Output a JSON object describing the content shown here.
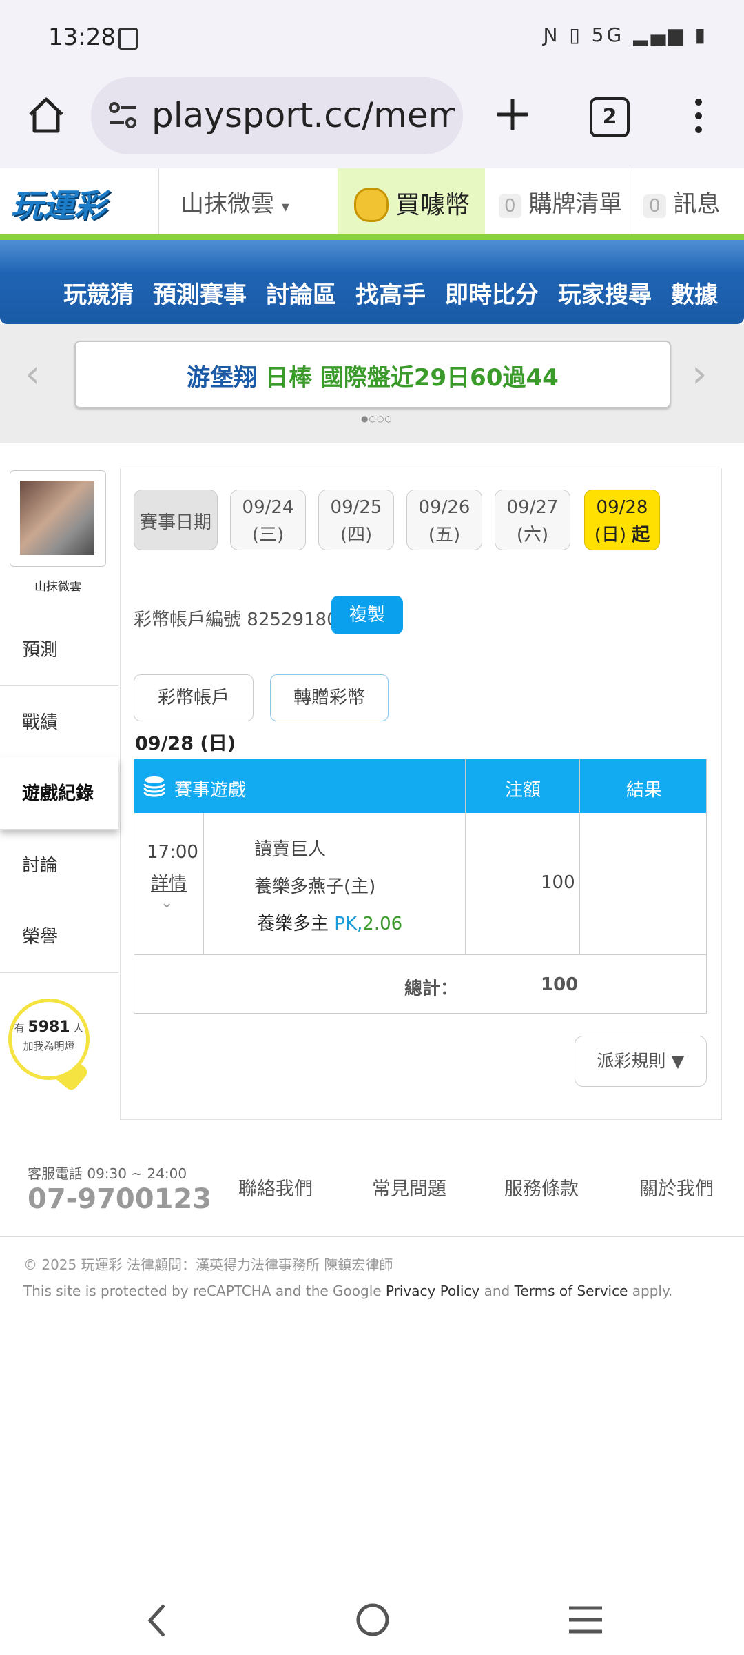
{
  "status": {
    "time": "13:28",
    "network": "5G"
  },
  "browser": {
    "url": "playsport.cc/memk",
    "tab_count": "2"
  },
  "header": {
    "logo": "玩運彩",
    "username": "山抹微雲",
    "buy_coin": "買噱幣",
    "cart_count": "0",
    "cart_label": "購牌清單",
    "msg_count": "0",
    "msg_label": "訊息"
  },
  "nav": [
    "玩競猜",
    "預測賽事",
    "討論區",
    "找高手",
    "即時比分",
    "玩家搜尋",
    "數據"
  ],
  "banner": {
    "name": "游堡翔",
    "league": "日棒",
    "text": "國際盤近29日60過44"
  },
  "sidebar": {
    "avatar_name": "山抹微雲",
    "items": [
      "預測",
      "戰績",
      "遊戲紀錄",
      "討論",
      "榮譽"
    ],
    "lightbulb": {
      "prefix": "有",
      "count": "5981",
      "suffix": "人",
      "text": "加我為明燈"
    }
  },
  "dates": {
    "label": "賽事日期",
    "items": [
      {
        "date": "09/24",
        "day": "(三)"
      },
      {
        "date": "09/25",
        "day": "(四)"
      },
      {
        "date": "09/26",
        "day": "(五)"
      },
      {
        "date": "09/27",
        "day": "(六)"
      },
      {
        "date": "09/28",
        "day": "(日)",
        "suffix": "起"
      }
    ]
  },
  "account": {
    "label": "彩幣帳戶編號",
    "number": "82529180",
    "copy": "複製"
  },
  "tabs": [
    "彩幣帳戶",
    "轉贈彩幣"
  ],
  "current_date": "09/28 (日)",
  "table": {
    "headers": [
      "賽事遊戲",
      "注額",
      "結果"
    ],
    "row": {
      "time": "17:00",
      "detail": "詳情",
      "team1": "讀賣巨人",
      "team2": "養樂多燕子(主)",
      "pick": "養樂多主",
      "odds": "PK,2.06",
      "amount": "100",
      "result": ""
    },
    "total_label": "總計：",
    "total": "100"
  },
  "rules_button": "派彩規則 ▼",
  "footer": {
    "hours": "客服電話 09:30 ~ 24:00",
    "phone": "07-9700123",
    "links": [
      "聯絡我們",
      "常見問題",
      "服務條款",
      "關於我們"
    ],
    "copyright": "© 2025 玩運彩 法律顧問：漢英得力法律事務所 陳鎮宏律師",
    "recaptcha_pre": "This site is protected by reCAPTCHA and the Google",
    "privacy": "Privacy Policy",
    "and": "and",
    "terms": "Terms of Service",
    "apply": "apply."
  },
  "colors": {
    "nav_blue": "#1f64b4",
    "accent_blue": "#12aaf0",
    "active_yellow": "#ffe000",
    "green": "#8ad13f",
    "odds_blue": "#1a9bd7",
    "pick_green": "#3a9a2a"
  }
}
